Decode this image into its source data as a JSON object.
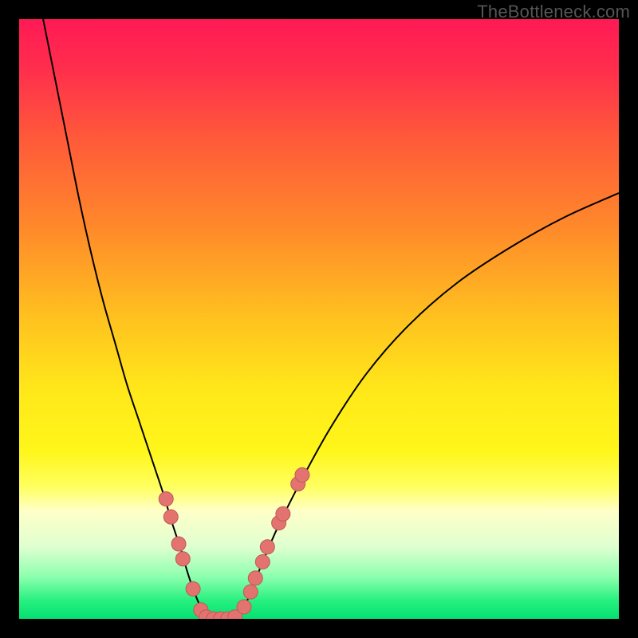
{
  "attribution": "TheBottleneck.com",
  "colors": {
    "gradient_stops": [
      {
        "offset": 0.0,
        "color": "#ff1a55"
      },
      {
        "offset": 0.08,
        "color": "#ff2d4d"
      },
      {
        "offset": 0.2,
        "color": "#ff5a3a"
      },
      {
        "offset": 0.35,
        "color": "#ff8a2a"
      },
      {
        "offset": 0.5,
        "color": "#ffc21f"
      },
      {
        "offset": 0.62,
        "color": "#ffe81a"
      },
      {
        "offset": 0.72,
        "color": "#fff61a"
      },
      {
        "offset": 0.78,
        "color": "#ffff60"
      },
      {
        "offset": 0.82,
        "color": "#ffffc8"
      },
      {
        "offset": 0.88,
        "color": "#dfffd0"
      },
      {
        "offset": 0.93,
        "color": "#8cffae"
      },
      {
        "offset": 0.97,
        "color": "#26f07f"
      },
      {
        "offset": 1.0,
        "color": "#05e072"
      }
    ],
    "curve": "#000000",
    "marker_fill": "#e2736f",
    "marker_stroke": "#c05a57",
    "frame_bg": "#000000"
  },
  "chart_data": {
    "type": "line",
    "title": "",
    "xlabel": "",
    "ylabel": "",
    "xlim": [
      0,
      100
    ],
    "ylim": [
      0,
      100
    ],
    "series": [
      {
        "name": "left-branch",
        "x": [
          4,
          6,
          8,
          10,
          12,
          14,
          16,
          18,
          20,
          22,
          24,
          25.5,
          27,
          28,
          29,
          30,
          30.8
        ],
        "y": [
          100,
          90,
          80,
          70,
          61,
          53,
          46,
          39,
          33,
          27,
          21,
          16,
          11.5,
          8,
          5,
          2.5,
          0.5
        ]
      },
      {
        "name": "valley",
        "x": [
          30.8,
          32,
          33.5,
          35,
          36.5
        ],
        "y": [
          0.5,
          0,
          0,
          0,
          0.5
        ]
      },
      {
        "name": "right-branch",
        "x": [
          36.5,
          38,
          40,
          43,
          47,
          52,
          58,
          65,
          73,
          82,
          91,
          100
        ],
        "y": [
          0.5,
          3,
          8,
          15,
          23,
          32,
          41,
          49,
          56,
          62,
          67,
          71
        ]
      }
    ],
    "markers": {
      "name": "highlighted-points",
      "points": [
        {
          "x": 24.5,
          "y": 20
        },
        {
          "x": 25.3,
          "y": 17
        },
        {
          "x": 26.6,
          "y": 12.5
        },
        {
          "x": 27.3,
          "y": 10
        },
        {
          "x": 29.0,
          "y": 5
        },
        {
          "x": 30.3,
          "y": 1.5
        },
        {
          "x": 31.2,
          "y": 0.3
        },
        {
          "x": 32.4,
          "y": 0
        },
        {
          "x": 33.6,
          "y": 0
        },
        {
          "x": 34.8,
          "y": 0
        },
        {
          "x": 36.0,
          "y": 0.3
        },
        {
          "x": 37.5,
          "y": 2
        },
        {
          "x": 38.6,
          "y": 4.5
        },
        {
          "x": 39.4,
          "y": 6.8
        },
        {
          "x": 40.6,
          "y": 9.5
        },
        {
          "x": 41.4,
          "y": 12
        },
        {
          "x": 43.3,
          "y": 16
        },
        {
          "x": 44.0,
          "y": 17.5
        },
        {
          "x": 46.5,
          "y": 22.5
        },
        {
          "x": 47.2,
          "y": 24
        }
      ]
    }
  }
}
